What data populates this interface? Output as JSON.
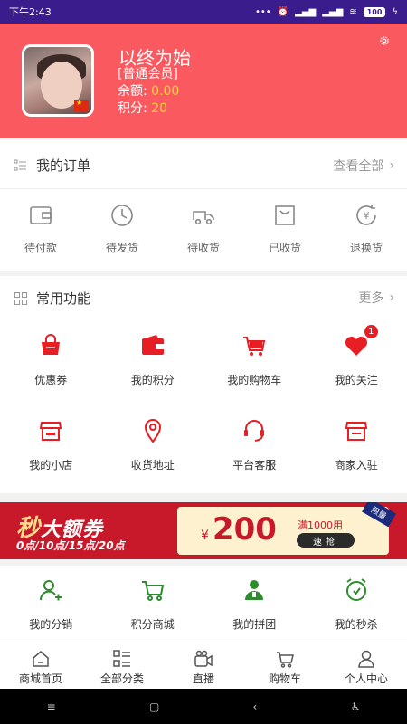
{
  "status_bar": {
    "time": "下午2:43",
    "battery": "100"
  },
  "profile": {
    "name": "以终为始",
    "level": "[普通会员]",
    "balance_label": "余额:",
    "balance_value": "0.00",
    "points_label": "积分:",
    "points_value": "20"
  },
  "orders": {
    "title": "我的订单",
    "more": "查看全部",
    "items": [
      {
        "label": "待付款",
        "icon": "wallet-icon"
      },
      {
        "label": "待发货",
        "icon": "clock-icon"
      },
      {
        "label": "待收货",
        "icon": "truck-icon"
      },
      {
        "label": "已收货",
        "icon": "bag-icon"
      },
      {
        "label": "退换货",
        "icon": "refund-icon"
      }
    ]
  },
  "features": {
    "title": "常用功能",
    "more": "更多",
    "items": [
      {
        "label": "优惠券",
        "icon": "basket-icon"
      },
      {
        "label": "我的积分",
        "icon": "wallet-icon"
      },
      {
        "label": "我的购物车",
        "icon": "cart-icon"
      },
      {
        "label": "我的关注",
        "icon": "heart-icon",
        "badge": "1"
      },
      {
        "label": "我的小店",
        "icon": "store-icon"
      },
      {
        "label": "收货地址",
        "icon": "location-pin-icon"
      },
      {
        "label": "平台客服",
        "icon": "headset-icon"
      },
      {
        "label": "商家入驻",
        "icon": "shop-icon"
      }
    ]
  },
  "promo_banner": {
    "flash": "秒",
    "title": "大额券",
    "times": "0点/10点/15点/20点",
    "currency": "¥",
    "amount": "200",
    "condition": "满1000用",
    "grab": "速抢",
    "limited": "限量"
  },
  "extras": {
    "items": [
      {
        "label": "我的分销",
        "icon": "user-add-icon"
      },
      {
        "label": "积分商城",
        "icon": "cart-icon"
      },
      {
        "label": "我的拼团",
        "icon": "group-icon"
      },
      {
        "label": "我的秒杀",
        "icon": "alarm-clock-icon"
      }
    ]
  },
  "tabbar": {
    "items": [
      {
        "label": "商城首页",
        "icon": "home-icon"
      },
      {
        "label": "全部分类",
        "icon": "category-icon"
      },
      {
        "label": "直播",
        "icon": "video-camera-icon"
      },
      {
        "label": "购物车",
        "icon": "cart-icon"
      },
      {
        "label": "个人中心",
        "icon": "user-icon"
      }
    ]
  },
  "colors": {
    "header": "#fa5a5f",
    "accent_red": "#e81e25",
    "green": "#2e8b2e",
    "status_bar": "#3b1c8c"
  }
}
